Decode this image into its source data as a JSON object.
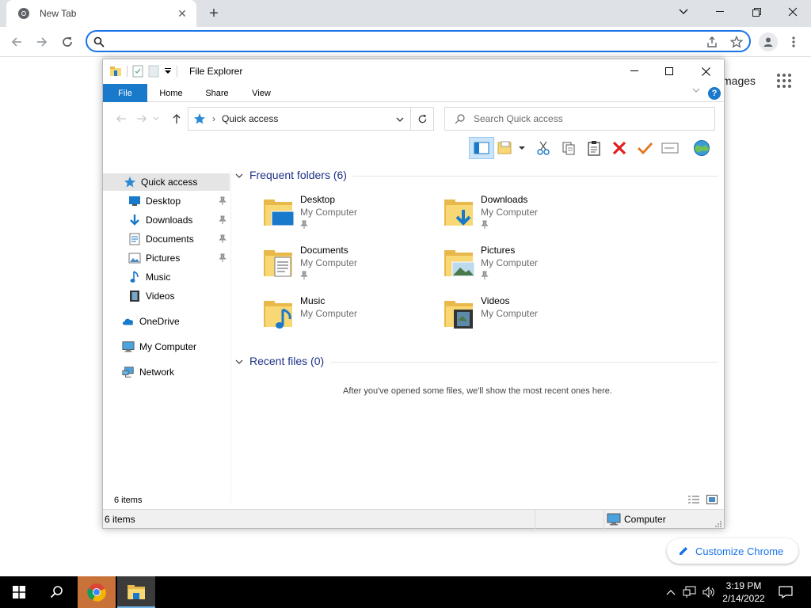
{
  "browser": {
    "tab_title": "New Tab",
    "omnibox_value": "",
    "ntp_images_label": "mages",
    "customize_label": "Customize Chrome"
  },
  "explorer": {
    "title": "File Explorer",
    "ribbon_tabs": [
      "File",
      "Home",
      "Share",
      "View"
    ],
    "address_crumb": "Quick access",
    "search_placeholder": "Search Quick access",
    "nav": {
      "quick_access": "Quick access",
      "items": [
        "Desktop",
        "Downloads",
        "Documents",
        "Pictures",
        "Music",
        "Videos"
      ],
      "onedrive": "OneDrive",
      "computer": "My Computer",
      "network": "Network"
    },
    "frequent_header": "Frequent folders (6)",
    "folders": [
      {
        "name": "Desktop",
        "location": "My Computer",
        "pinned": true
      },
      {
        "name": "Downloads",
        "location": "My Computer",
        "pinned": true
      },
      {
        "name": "Documents",
        "location": "My Computer",
        "pinned": true
      },
      {
        "name": "Pictures",
        "location": "My Computer",
        "pinned": true
      },
      {
        "name": "Music",
        "location": "My Computer",
        "pinned": false
      },
      {
        "name": "Videos",
        "location": "My Computer",
        "pinned": false
      }
    ],
    "recent_header": "Recent files (0)",
    "recent_empty": "After you've opened some files, we'll show the most recent ones here.",
    "items_count": "6 items",
    "status_items": "6 items",
    "status_location": "Computer"
  },
  "taskbar": {
    "time": "3:19 PM",
    "date": "2/14/2022"
  },
  "colors": {
    "accent_blue": "#1a73e8",
    "ribbon_file": "#1979ca",
    "group_header": "#1e3287",
    "folder_yellow": "#f8d775"
  }
}
